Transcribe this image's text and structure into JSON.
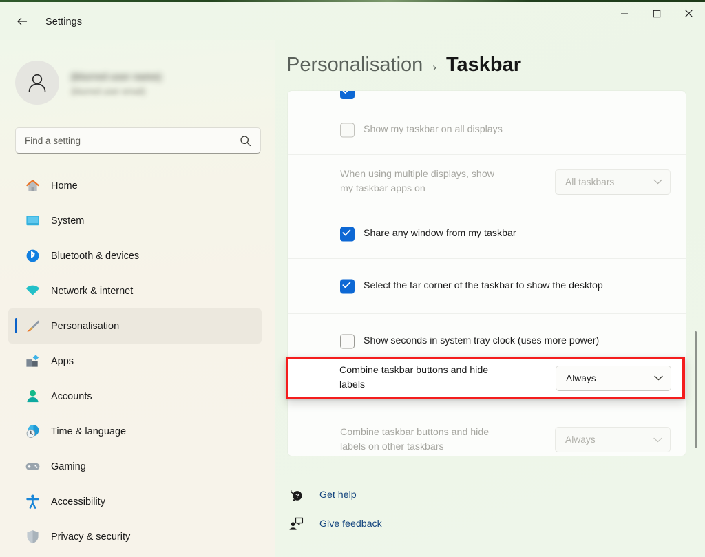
{
  "window": {
    "title": "Settings",
    "back_icon": "back-arrow-icon",
    "controls": {
      "minimize": "minimize-icon",
      "maximize": "maximize-icon",
      "close": "close-icon"
    }
  },
  "sidebar": {
    "profile": {
      "name": "(blurred user name)",
      "email": "(blurred user email)",
      "avatar_icon": "person-avatar-icon"
    },
    "search": {
      "placeholder": "Find a setting",
      "icon": "search-icon"
    },
    "items": [
      {
        "label": "Home",
        "icon": "home-icon",
        "active": false
      },
      {
        "label": "System",
        "icon": "system-icon",
        "active": false
      },
      {
        "label": "Bluetooth & devices",
        "icon": "bluetooth-icon",
        "active": false
      },
      {
        "label": "Network & internet",
        "icon": "wifi-icon",
        "active": false
      },
      {
        "label": "Personalisation",
        "icon": "paintbrush-icon",
        "active": true
      },
      {
        "label": "Apps",
        "icon": "apps-icon",
        "active": false
      },
      {
        "label": "Accounts",
        "icon": "accounts-icon",
        "active": false
      },
      {
        "label": "Time & language",
        "icon": "clock-globe-icon",
        "active": false
      },
      {
        "label": "Gaming",
        "icon": "gamepad-icon",
        "active": false
      },
      {
        "label": "Accessibility",
        "icon": "accessibility-icon",
        "active": false
      },
      {
        "label": "Privacy & security",
        "icon": "shield-icon",
        "active": false
      }
    ]
  },
  "main": {
    "breadcrumb": {
      "parent": "Personalisation",
      "separator": "›",
      "current": "Taskbar"
    },
    "settings_rows": [
      {
        "label": "Show my taskbar on all displays",
        "control": "checkbox",
        "checked": false,
        "disabled": true
      },
      {
        "label": "When using multiple displays, show my taskbar apps on",
        "control": "dropdown",
        "value": "All taskbars",
        "disabled": true
      },
      {
        "label": "Share any window from my taskbar",
        "control": "checkbox",
        "checked": true,
        "disabled": false
      },
      {
        "label": "Select the far corner of the taskbar to show the desktop",
        "control": "checkbox",
        "checked": true,
        "disabled": false
      },
      {
        "label": "Show seconds in system tray clock (uses more power)",
        "control": "checkbox",
        "checked": false,
        "disabled": false
      },
      {
        "label": "Combine taskbar buttons and hide labels on other taskbars",
        "control": "dropdown",
        "value": "Always",
        "disabled": true
      }
    ],
    "highlighted_row": {
      "label": "Combine taskbar buttons and hide labels",
      "control": "dropdown",
      "value": "Always",
      "highlight_color": "#f41d1d"
    },
    "footer_links": [
      {
        "label": "Get help",
        "icon": "help-question-icon"
      },
      {
        "label": "Give feedback",
        "icon": "feedback-icon"
      }
    ],
    "link_color": "#14457e"
  }
}
